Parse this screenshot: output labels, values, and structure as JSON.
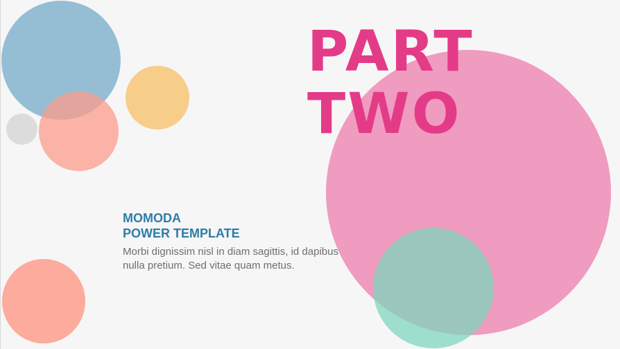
{
  "slide": {
    "headline": {
      "line1": "PART",
      "line2": "TWO"
    },
    "title": {
      "line1": "MOMODA",
      "line2": "POWER TEMPLATE"
    },
    "body": "Morbi dignissim nisl in diam sagittis, id dapibus nulla pretium. Sed vitae quam metus."
  },
  "colors": {
    "accent_pink": "#e43b88",
    "title_blue": "#2d7da8",
    "body_gray": "#6e6e6e",
    "background": "#f6f6f6",
    "circle_blue": "#8fbbd2",
    "circle_yellow": "#f7ca84",
    "circle_gray": "#dcdcdc",
    "circle_salmon": "#fc9c8c",
    "circle_pink": "#ef96bd",
    "circle_mint": "#80d6be"
  }
}
